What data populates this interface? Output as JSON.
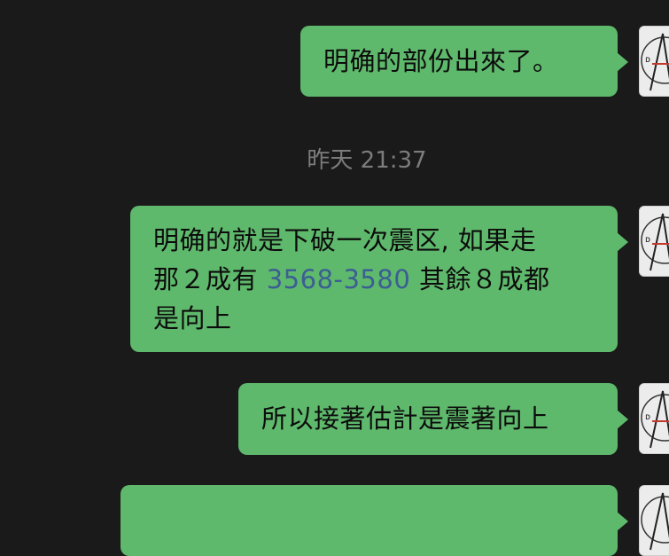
{
  "messages": [
    {
      "text": "明确的部份出來了。"
    },
    {
      "line1": "明确的就是下破一次震区, 如果走",
      "line2_pre": "那２成有 ",
      "line2_link": "3568-3580",
      "line2_post": "  其餘８成都",
      "line3": "是向上"
    },
    {
      "text": "所以接著估計是震著向上"
    },
    {
      "text": ""
    }
  ],
  "timestamp": "昨天 21:37",
  "colors": {
    "background": "#1a1a1a",
    "bubble": "#5fb96c",
    "link": "#3b5e93",
    "timestamp": "#7c7c7c"
  },
  "icons": {
    "avatar": "user-avatar-icon"
  }
}
